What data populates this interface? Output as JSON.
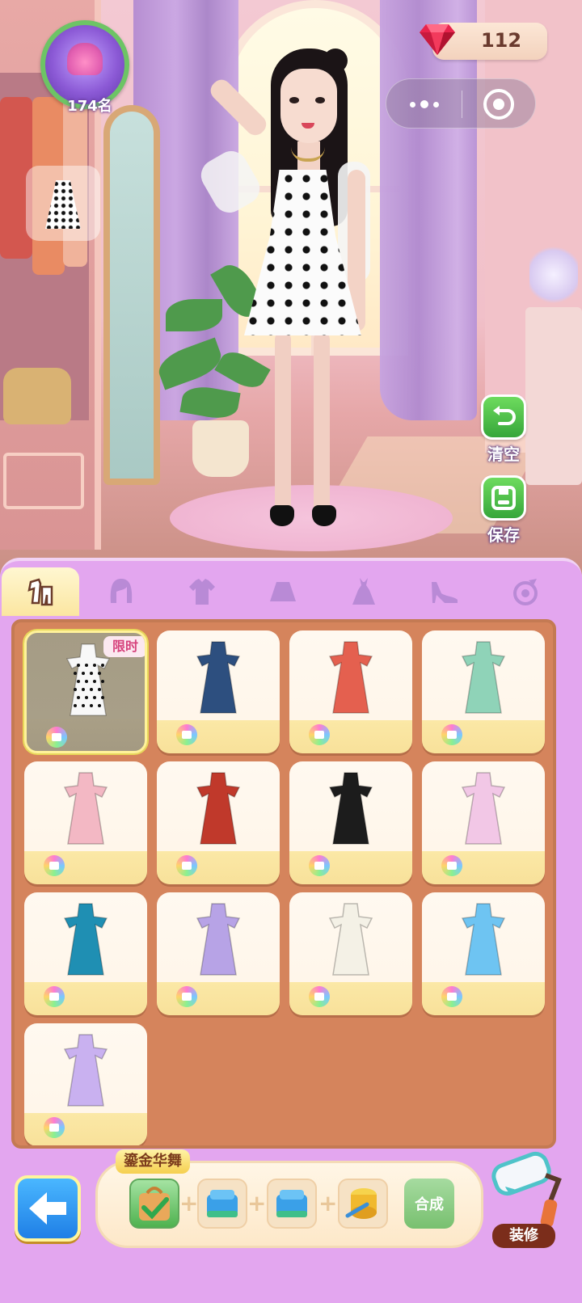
{
  "rank": {
    "label": "174名"
  },
  "currency": {
    "gem_count": "112",
    "icon": "ruby-gem-icon"
  },
  "miniprogram_capsule": {
    "more_icon": "more-dots-icon",
    "close_icon": "target-close-icon"
  },
  "side_actions": [
    {
      "label": "清空",
      "icon": "undo-arrow-icon"
    },
    {
      "label": "保存",
      "icon": "save-disk-icon"
    }
  ],
  "category_tabs": [
    {
      "id": "outfit",
      "icon": "outfit-set-icon",
      "active": true
    },
    {
      "id": "hair",
      "icon": "hair-icon",
      "active": false
    },
    {
      "id": "top",
      "icon": "shirt-icon",
      "active": false
    },
    {
      "id": "skirt",
      "icon": "skirt-icon",
      "active": false
    },
    {
      "id": "dress",
      "icon": "dress-icon",
      "active": false
    },
    {
      "id": "shoes",
      "icon": "high-heel-icon",
      "active": false
    },
    {
      "id": "accessory",
      "icon": "accessory-icon",
      "active": false
    }
  ],
  "items": [
    {
      "name": "polka-dot-dress",
      "badge": "限时",
      "selected": true,
      "color": "#222222"
    },
    {
      "name": "denim-overalls",
      "badge": "",
      "selected": false,
      "color": "#2d4f7f"
    },
    {
      "name": "red-jacket-pink-skirt",
      "badge": "",
      "selected": false,
      "color": "#e4604f"
    },
    {
      "name": "mint-qipao-top-white-skirt",
      "badge": "",
      "selected": false,
      "color": "#8fd3b8"
    },
    {
      "name": "pink-floral-gown",
      "badge": "",
      "selected": false,
      "color": "#f3b8c4"
    },
    {
      "name": "green-red-traditional-dress",
      "badge": "",
      "selected": false,
      "color": "#c0392b"
    },
    {
      "name": "black-gothic-robe",
      "badge": "",
      "selected": false,
      "color": "#1c1c1c"
    },
    {
      "name": "pink-romper",
      "badge": "",
      "selected": false,
      "color": "#f2c7e6"
    },
    {
      "name": "teal-blue-ethnic-dress",
      "badge": "",
      "selected": false,
      "color": "#1f8fb3"
    },
    {
      "name": "lavender-hanfu",
      "badge": "",
      "selected": false,
      "color": "#b7a3e6"
    },
    {
      "name": "white-embroidered-dress",
      "badge": "",
      "selected": false,
      "color": "#f4f1e6"
    },
    {
      "name": "blue-ice-gown",
      "badge": "",
      "selected": false,
      "color": "#6ec4f2"
    },
    {
      "name": "lilac-fairy-dress",
      "badge": "",
      "selected": false,
      "color": "#c9b1f0"
    }
  ],
  "synthesis": {
    "title": "鎏金华舞",
    "materials": [
      {
        "icon": "green-bag-checked-icon"
      },
      {
        "icon": "blue-fabric-icon"
      },
      {
        "icon": "blue-fabric-icon"
      },
      {
        "icon": "yellow-thread-icon"
      }
    ],
    "plus": "+",
    "combine_label": "合成"
  },
  "back_button": {
    "icon": "back-arrow-icon"
  },
  "decorate_button": {
    "label": "装修",
    "icon": "paint-roller-icon"
  }
}
